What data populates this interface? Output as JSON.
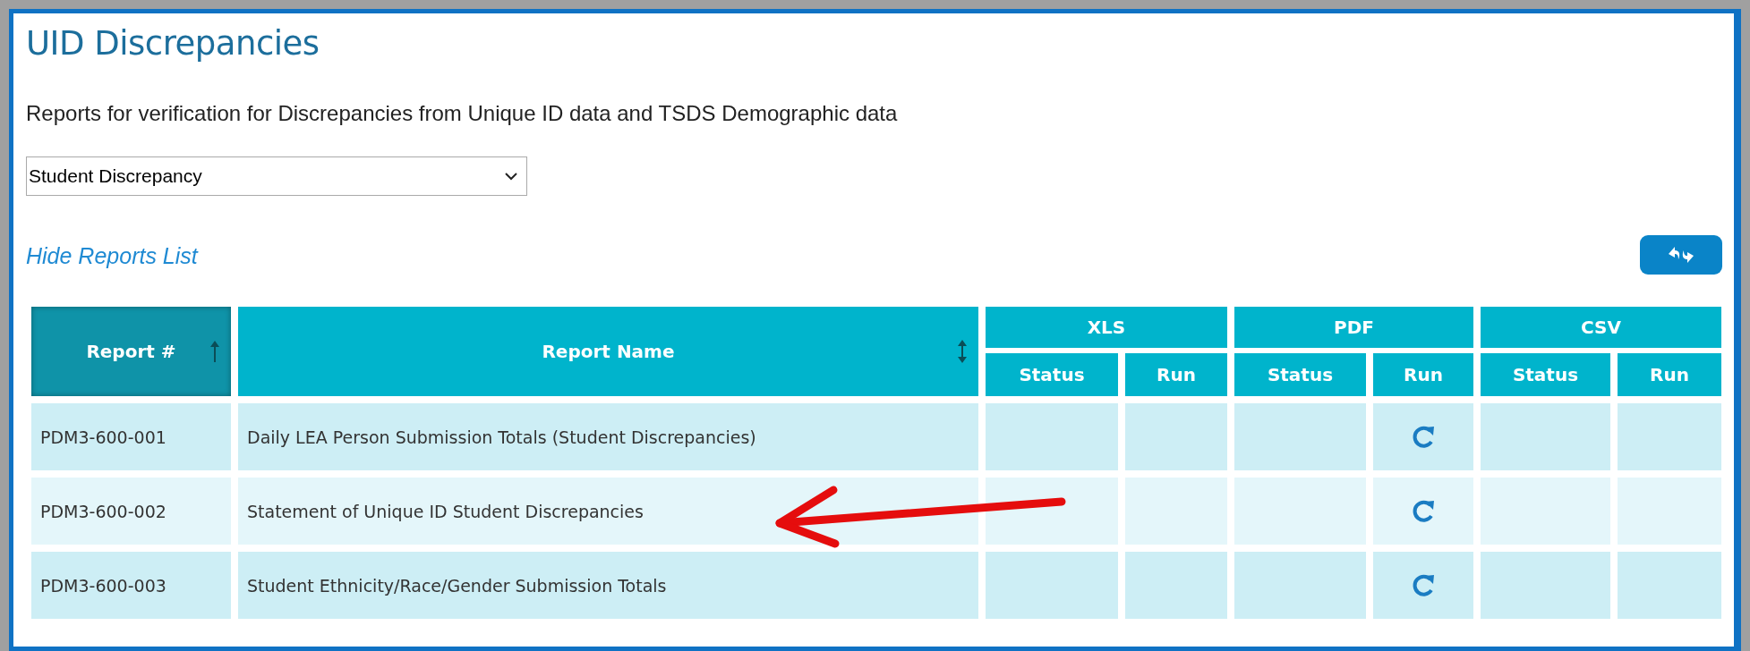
{
  "page": {
    "title": "UID Discrepancies",
    "description": "Reports for verification for Discrepancies from Unique ID data and TSDS Demographic data",
    "report_type": {
      "value": "Student Discrepancy"
    },
    "toggle_link": "Hide Reports List"
  },
  "table": {
    "columns": [
      {
        "label": "Report #",
        "sorted": true
      },
      {
        "label": "Report Name",
        "sorted": false
      }
    ],
    "formats": [
      {
        "label": "XLS",
        "status_label": "Status",
        "run_label": "Run"
      },
      {
        "label": "PDF",
        "status_label": "Status",
        "run_label": "Run"
      },
      {
        "label": "CSV",
        "status_label": "Status",
        "run_label": "Run"
      }
    ],
    "rows": [
      {
        "report_no": "PDM3-600-001",
        "name": "Daily LEA Person Submission Totals (Student Discrepancies)",
        "runs": [
          {
            "available": false
          },
          {
            "available": true
          },
          {
            "available": false
          }
        ]
      },
      {
        "report_no": "PDM3-600-002",
        "name": "Statement of Unique ID Student Discrepancies",
        "runs": [
          {
            "available": false
          },
          {
            "available": true
          },
          {
            "available": false
          }
        ]
      },
      {
        "report_no": "PDM3-600-003",
        "name": "Student Ethnicity/Race/Gender Submission Totals",
        "runs": [
          {
            "available": false
          },
          {
            "available": true
          },
          {
            "available": false
          }
        ]
      }
    ]
  }
}
